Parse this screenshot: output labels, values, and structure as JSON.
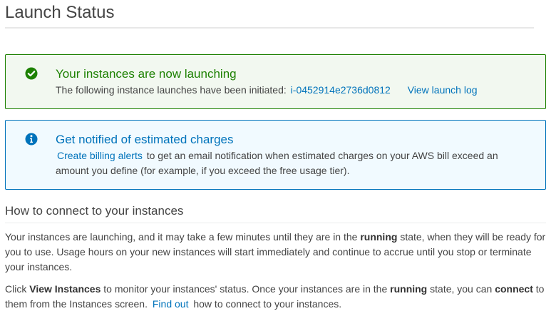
{
  "page": {
    "title": "Launch Status"
  },
  "success_alert": {
    "heading": "Your instances are now launching",
    "body_prefix": "The following instance launches have been initiated:",
    "instance_id": "i-0452914e2736d0812",
    "view_launch_log": "View launch log",
    "icon": "check-circle-icon",
    "color": "#1d8102"
  },
  "info_alert": {
    "heading": "Get notified of estimated charges",
    "billing_link": "Create billing alerts",
    "body_suffix": "to get an email notification when estimated charges on your AWS bill exceed an amount you define (for example, if you exceed the free usage tier).",
    "icon": "info-circle-icon",
    "color": "#0073bb"
  },
  "connect_section": {
    "title": "How to connect to your instances",
    "para1": {
      "part1": "Your instances are launching, and it may take a few minutes until they are in the",
      "bold1": "running",
      "part2": "state, when they will be ready for you to use. Usage hours on your new instances will start immediately and continue to accrue until you stop or terminate your instances."
    },
    "para2": {
      "part1": "Click",
      "bold1": "View Instances",
      "part2": "to monitor your instances' status. Once your instances are in the",
      "bold2": "running",
      "part3": "state, you can",
      "bold3": "connect",
      "part4": "to them from the Instances screen.",
      "find_out_link": "Find out",
      "part5": "how to connect to your instances."
    }
  }
}
